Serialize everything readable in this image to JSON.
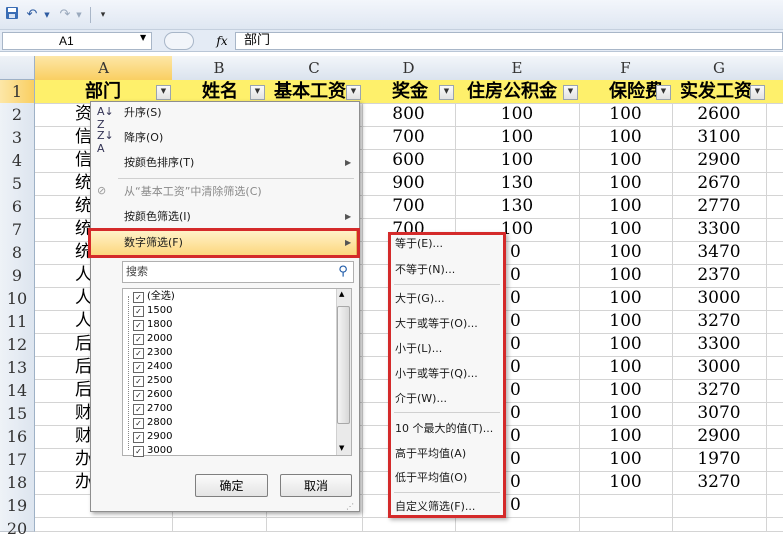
{
  "toolbar": {
    "save_icon": "save-icon",
    "undo_icon": "undo-icon",
    "redo_icon": "redo-icon",
    "customize_icon": "customize-icon"
  },
  "formula_bar": {
    "name_box": "A1",
    "fx_label": "fx",
    "formula": "部门"
  },
  "columns": [
    "A",
    "B",
    "C",
    "D",
    "E",
    "F",
    "G"
  ],
  "rows": [
    "1",
    "2",
    "3",
    "4",
    "5",
    "6",
    "7",
    "8",
    "9",
    "10",
    "11",
    "12",
    "13",
    "14",
    "15",
    "16",
    "17",
    "18",
    "19",
    "20"
  ],
  "headers": [
    "部门",
    "姓名",
    "基本工资",
    "奖金",
    "住房公积金",
    "保险费",
    "实发工资"
  ],
  "visible_cells": {
    "A": [
      "资",
      "信",
      "信",
      "统",
      "统",
      "统",
      "统",
      "人",
      "人",
      "人",
      "后",
      "后",
      "后",
      "财",
      "财",
      "办",
      "办"
    ],
    "D": [
      "800",
      "700",
      "600",
      "900",
      "700",
      "700"
    ],
    "E": [
      "100",
      "100",
      "100",
      "130",
      "130",
      "100"
    ],
    "E_edge": [
      "0",
      "0",
      "0",
      "0",
      "0",
      "0",
      "0",
      "0",
      "0",
      "0",
      "0",
      "0"
    ],
    "F": [
      "100",
      "100",
      "100",
      "100",
      "100",
      "100",
      "100",
      "100",
      "100",
      "100",
      "100",
      "100",
      "100",
      "100",
      "100",
      "100",
      "100"
    ],
    "G": [
      "2600",
      "3100",
      "2900",
      "2670",
      "2770",
      "3300",
      "3470",
      "2370",
      "3000",
      "3270",
      "3300",
      "3000",
      "3270",
      "3070",
      "2900",
      "1970",
      "3270"
    ]
  },
  "filter_menu": {
    "sort_asc": "升序(S)",
    "sort_desc": "降序(O)",
    "sort_by_color": "按颜色排序(T)",
    "clear_filter": "从“基本工资”中清除筛选(C)",
    "filter_by_color": "按颜色筛选(I)",
    "number_filter": "数字筛选(F)",
    "search_placeholder": "搜索",
    "items": [
      "(全选)",
      "1500",
      "1800",
      "2000",
      "2300",
      "2400",
      "2500",
      "2600",
      "2700",
      "2800",
      "2900",
      "3000"
    ],
    "ok": "确定",
    "cancel": "取消"
  },
  "number_filter_submenu": [
    "等于(E)...",
    "不等于(N)...",
    "大于(G)...",
    "大于或等于(O)...",
    "小于(L)...",
    "小于或等于(Q)...",
    "介于(W)...",
    "10 个最大的值(T)...",
    "高于平均值(A)",
    "低于平均值(O)",
    "自定义筛选(F)..."
  ],
  "colors": {
    "header_row": "#fef06b",
    "selected_col": "#f9cf62",
    "highlight_box": "#d42a2a"
  }
}
